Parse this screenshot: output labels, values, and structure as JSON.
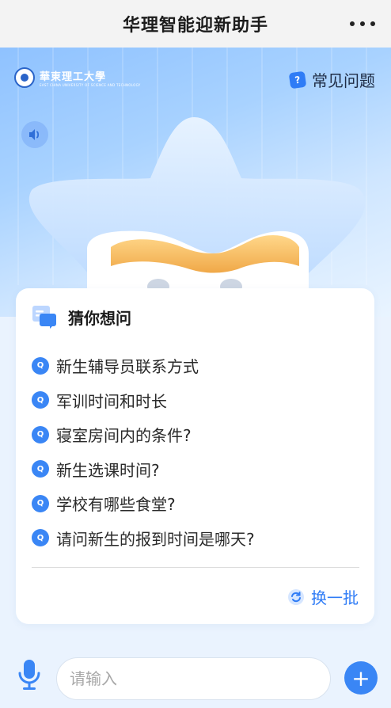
{
  "header": {
    "title": "华理智能迎新助手",
    "more_icon": "more-dots-icon"
  },
  "hero": {
    "logo_text": "華東理工大學",
    "logo_subtext": "EAST CHINA UNIVERSITY OF SCIENCE AND TECHNOLOGY",
    "faq_label": "常见问题",
    "faq_icon": "question-chat-icon",
    "sound_icon": "speaker-icon",
    "mascot": "star-mascot"
  },
  "suggestions": {
    "title": "猜你想问",
    "title_icon": "chat-bubbles-icon",
    "badge": "Q",
    "items": [
      {
        "label": "新生辅导员联系方式"
      },
      {
        "label": "军训时间和时长"
      },
      {
        "label": "寝室房间内的条件?"
      },
      {
        "label": "新生选课时间?"
      },
      {
        "label": "学校有哪些食堂?"
      },
      {
        "label": "请问新生的报到时间是哪天?"
      }
    ],
    "refresh_label": "换一批",
    "refresh_icon": "refresh-icon"
  },
  "input_bar": {
    "placeholder": "请输入",
    "mic_icon": "microphone-icon",
    "add_icon": "plus-icon",
    "add_symbol": "+"
  },
  "colors": {
    "accent": "#3a86f5",
    "header_bg": "#f3f3f3",
    "page_bg": "#eaf3fe"
  }
}
